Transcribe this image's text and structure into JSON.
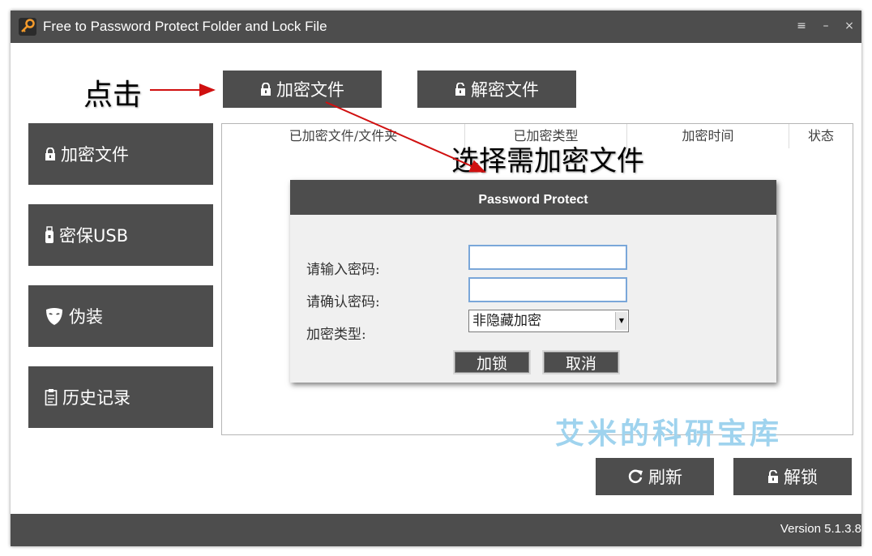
{
  "window": {
    "title": "Free to Password Protect Folder and Lock File"
  },
  "titlebar": {
    "menu_glyph": "≡",
    "minimize_glyph": "–",
    "close_glyph": "×"
  },
  "toolbar": {
    "encrypt_label": "加密文件",
    "decrypt_label": "解密文件"
  },
  "sidebar": {
    "items": [
      {
        "label": "加密文件",
        "icon": "lock-icon"
      },
      {
        "label": "密保USB",
        "icon": "usb-icon"
      },
      {
        "label": "伪装",
        "icon": "mask-icon"
      },
      {
        "label": "历史记录",
        "icon": "clipboard-icon"
      }
    ]
  },
  "table": {
    "columns": [
      "已加密文件/文件夹",
      "已加密类型",
      "加密时间",
      "状态"
    ]
  },
  "dialog": {
    "title": "Password Protect",
    "password_label": "请输入密码:",
    "confirm_label": "请确认密码:",
    "type_label": "加密类型:",
    "password_value": "",
    "confirm_value": "",
    "type_value": "非隐藏加密",
    "lock_button": "加锁",
    "cancel_button": "取消"
  },
  "actions": {
    "refresh_label": "刷新",
    "unlock_label": "解锁"
  },
  "annotations": {
    "click": "点击",
    "select": "选择需加密文件"
  },
  "watermark": "艾米的科研宝库",
  "footer": {
    "version": "Version 5.1.3.8"
  },
  "colors": {
    "dark": "#4d4d4d",
    "accent_orange": "#f39a2b",
    "arrow_red": "#d01010",
    "watermark": "#9fd3ee"
  }
}
